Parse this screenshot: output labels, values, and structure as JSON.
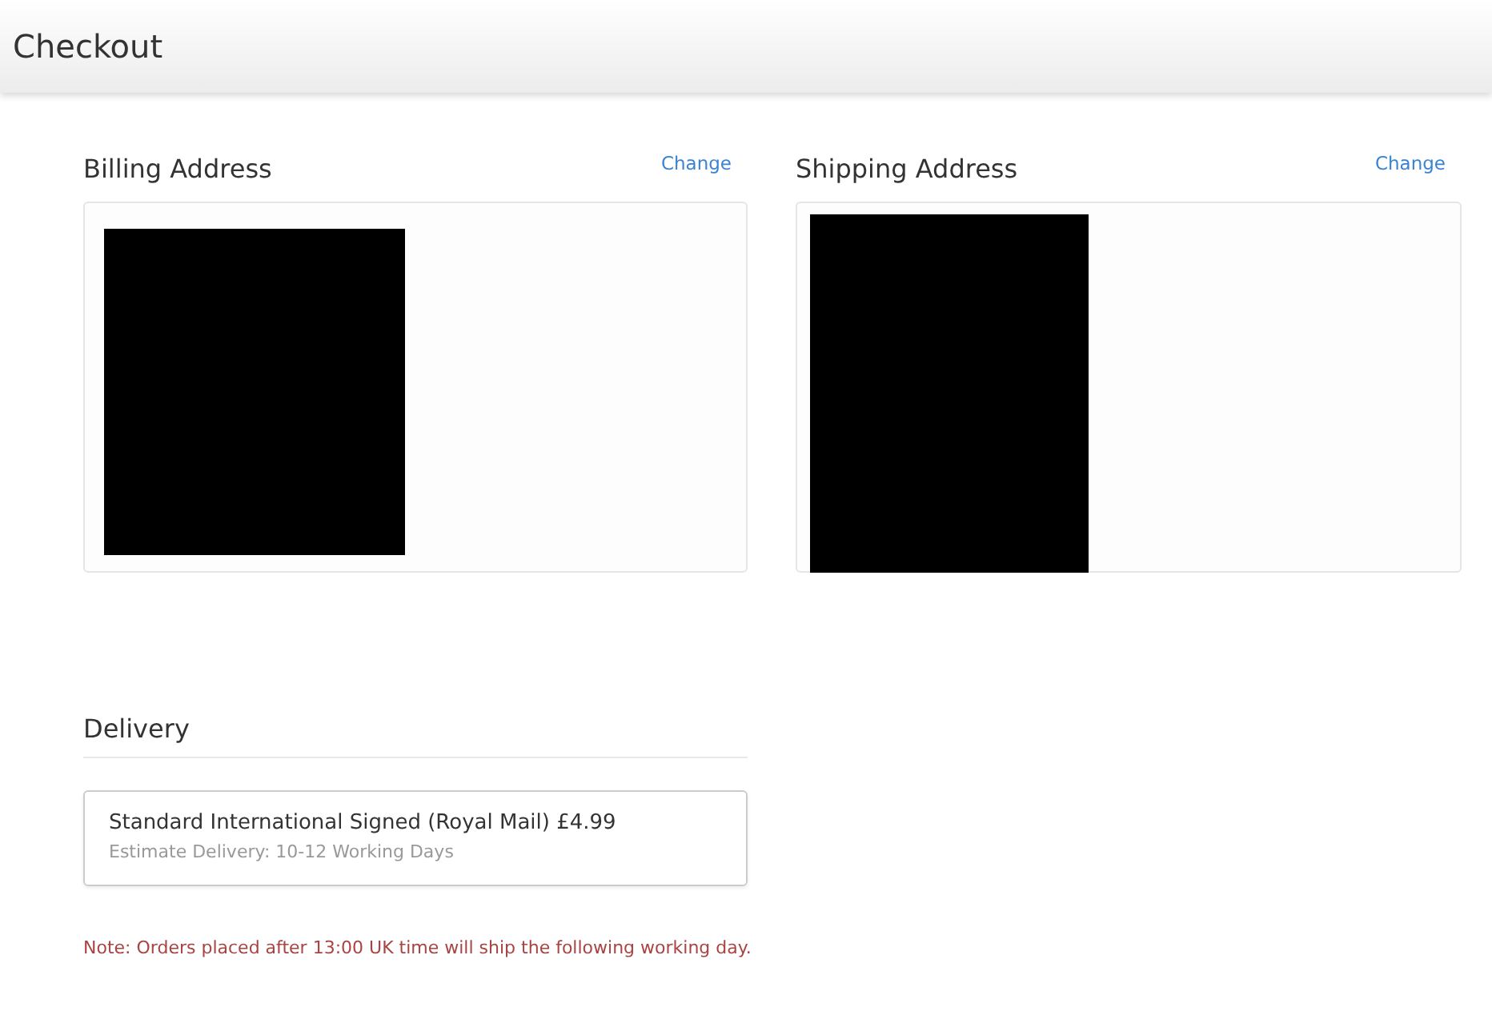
{
  "header": {
    "title": "Checkout"
  },
  "addresses": [
    {
      "heading": "Billing Address",
      "action": "Change"
    },
    {
      "heading": "Shipping Address",
      "action": "Change"
    }
  ],
  "delivery": {
    "heading": "Delivery",
    "options": [
      {
        "name": "Standard International Signed (Royal Mail) £4.99",
        "estimate": "Estimate Delivery: 10-12 Working Days"
      }
    ]
  },
  "note": "Note: Orders placed after 13:00 UK time will ship the following working day."
}
